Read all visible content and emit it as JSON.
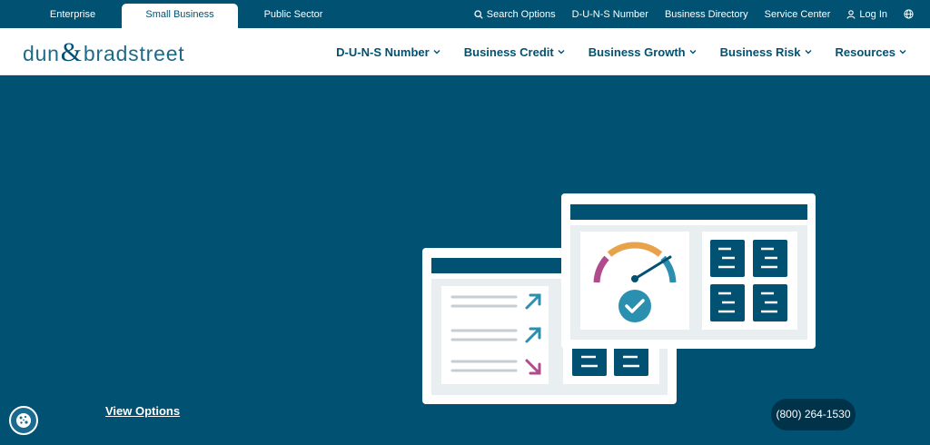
{
  "utility": {
    "tabs": [
      {
        "label": "Enterprise"
      },
      {
        "label": "Small Business"
      },
      {
        "label": "Public Sector"
      }
    ],
    "active_tab": "Small Business",
    "links": [
      {
        "label": "Search Options",
        "icon": "search-icon"
      },
      {
        "label": "D-U-N-S Number"
      },
      {
        "label": "Business Directory"
      },
      {
        "label": "Service Center"
      },
      {
        "label": "Log In",
        "icon": "user-icon"
      },
      {
        "icon": "globe-icon"
      }
    ]
  },
  "brand": {
    "part1": "dun",
    "amp": "&",
    "part2": "bradstreet"
  },
  "nav": {
    "items": [
      {
        "label": "D-U-N-S Number"
      },
      {
        "label": "Business Credit"
      },
      {
        "label": "Business Growth"
      },
      {
        "label": "Business Risk"
      },
      {
        "label": "Resources"
      }
    ]
  },
  "hero": {
    "view_options": "View Options",
    "phone": "(800) 264-1530"
  },
  "colors": {
    "brand_navy": "#005172",
    "dark_navy": "#00324a",
    "teal": "#2b8fb0",
    "magenta": "#b04b8c",
    "orange": "#e8a24a",
    "white": "#ffffff"
  }
}
